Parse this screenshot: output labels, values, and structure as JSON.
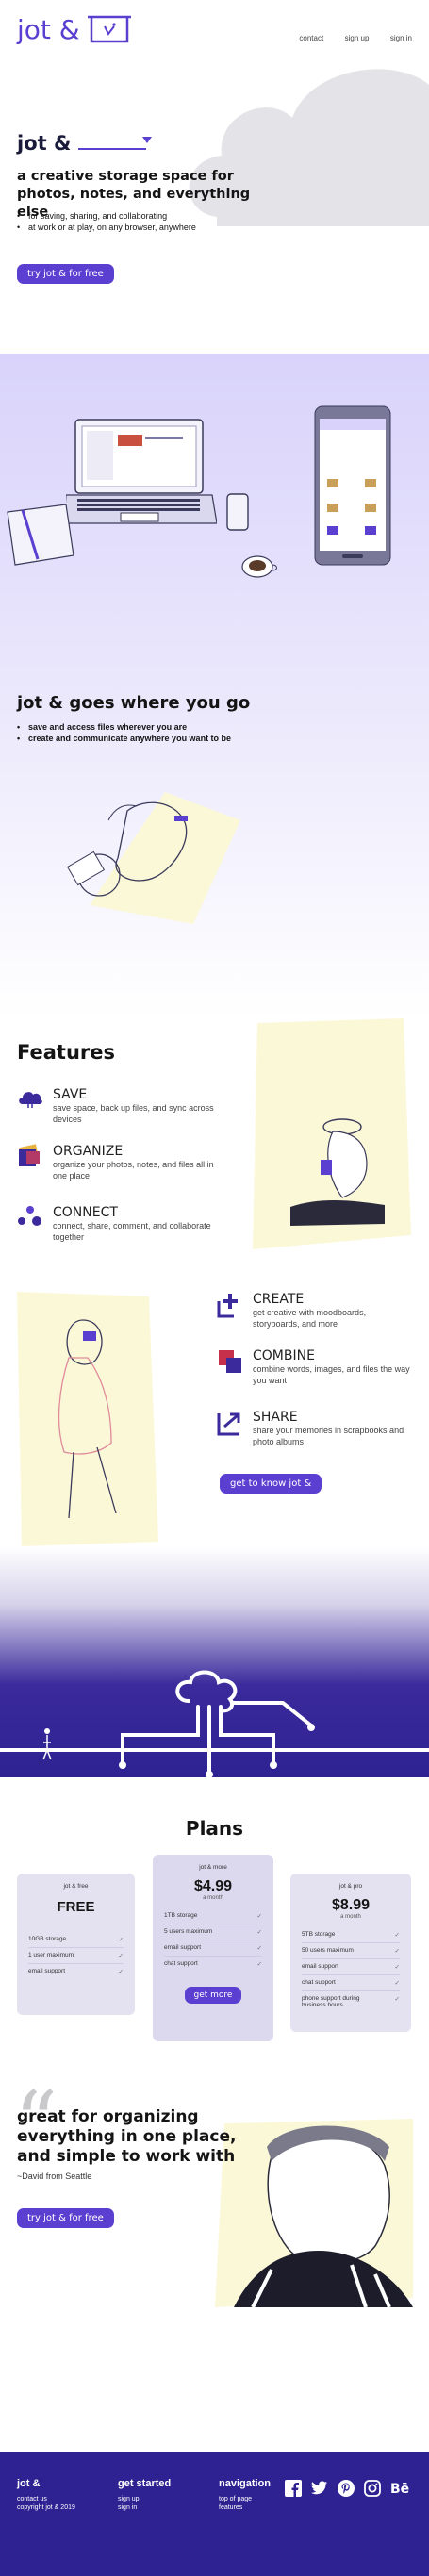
{
  "header": {
    "logo_text": "jot &",
    "nav": [
      "contact",
      "sign up",
      "sign in"
    ]
  },
  "hero": {
    "title": "jot &",
    "subtitle": "a creative storage space for photos, notes, and everything else",
    "bullets": [
      "for saving, sharing, and collaborating",
      "at work or at play, on any browser, anywhere"
    ],
    "cta": "try jot & for free"
  },
  "goes": {
    "title": "jot & goes where you go",
    "bullets": [
      "save and access files wherever you are",
      "create and communicate anywhere you want to be"
    ]
  },
  "features": {
    "heading": "Features",
    "items": [
      {
        "title": "SAVE",
        "desc": "save space, back up files, and sync across devices",
        "icon": "cloud-icon"
      },
      {
        "title": "ORGANIZE",
        "desc": "organize your photos, notes, and files all in one place",
        "icon": "folders-icon"
      },
      {
        "title": "CONNECT",
        "desc": "connect, share, comment, and collaborate together",
        "icon": "people-icon"
      }
    ],
    "items2": [
      {
        "title": "CREATE",
        "desc": "get creative with moodboards, storyboards, and more",
        "icon": "create-icon"
      },
      {
        "title": "COMBINE",
        "desc": "combine words, images, and files the way you want",
        "icon": "combine-icon"
      },
      {
        "title": "SHARE",
        "desc": "share your memories in scrapbooks and photo albums",
        "icon": "share-icon"
      }
    ],
    "cta": "get to know jot &"
  },
  "plans": {
    "heading": "Plans",
    "cards": [
      {
        "name": "jot & free",
        "price": "FREE",
        "period": "",
        "rows": [
          [
            "10GB storage",
            "✓"
          ],
          [
            "1 user maximum",
            "✓"
          ],
          [
            "email support",
            "✓"
          ]
        ],
        "cta": ""
      },
      {
        "name": "jot & more",
        "price": "$4.99",
        "period": "a month",
        "rows": [
          [
            "1TB storage",
            "✓"
          ],
          [
            "5 users maximum",
            "✓"
          ],
          [
            "email support",
            "✓"
          ],
          [
            "chat support",
            "✓"
          ]
        ],
        "cta": "get more"
      },
      {
        "name": "jot & pro",
        "price": "$8.99",
        "period": "a month",
        "rows": [
          [
            "5TB storage",
            "✓"
          ],
          [
            "50 users maximum",
            "✓"
          ],
          [
            "email support",
            "✓"
          ],
          [
            "chat support",
            "✓"
          ],
          [
            "phone support during business hours",
            "✓"
          ]
        ],
        "cta": ""
      }
    ]
  },
  "testimonial": {
    "quote": "great for organizing everything in one place, and simple to work with",
    "author": "~David from Seattle",
    "cta": "try jot & for free"
  },
  "footer": {
    "col1_title": "jot &",
    "col1_links": [
      "contact us",
      "copyright jot & 2019"
    ],
    "col2_title": "get started",
    "col2_links": [
      "sign up",
      "sign in"
    ],
    "col3_title": "navigation",
    "col3_links": [
      "top of page",
      "features"
    ],
    "social": [
      "facebook-icon",
      "twitter-icon",
      "pinterest-icon",
      "instagram-icon",
      "behance-icon"
    ]
  },
  "colors": {
    "accent": "#5b3fd0",
    "deep": "#3a2a9c",
    "cream": "#fbf8d8",
    "lavender": "#d9d3fb"
  }
}
